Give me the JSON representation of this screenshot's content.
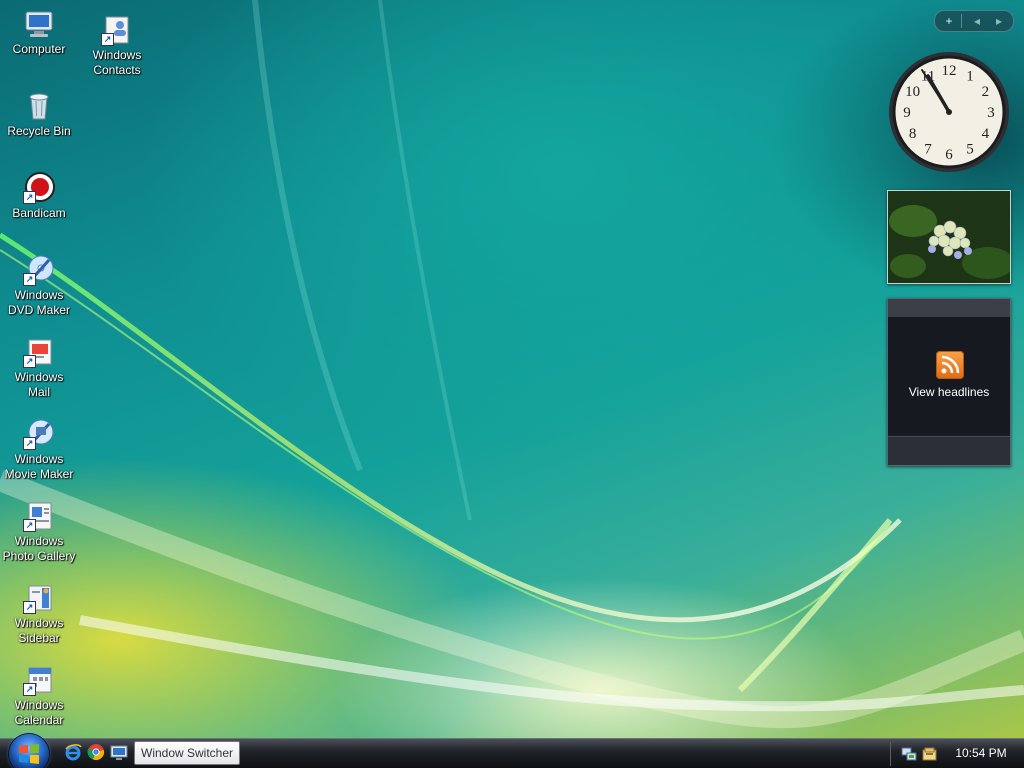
{
  "desktop": {
    "icons": [
      {
        "label": "Computer",
        "icon": "computer-icon"
      },
      {
        "label": "Windows\nContacts",
        "icon": "contacts-icon"
      },
      {
        "label": "Recycle Bin",
        "icon": "recycle-bin-icon"
      },
      {
        "label": "Bandicam",
        "icon": "bandicam-icon"
      },
      {
        "label": "Windows\nDVD Maker",
        "icon": "dvd-maker-icon"
      },
      {
        "label": "Windows\nMail",
        "icon": "mail-icon"
      },
      {
        "label": "Windows\nMovie Maker",
        "icon": "movie-maker-icon"
      },
      {
        "label": "Windows\nPhoto Gallery",
        "icon": "photo-gallery-icon"
      },
      {
        "label": "Windows\nSidebar",
        "icon": "sidebar-icon"
      },
      {
        "label": "Windows\nCalendar",
        "icon": "calendar-icon"
      }
    ]
  },
  "sidebar": {
    "controls": {
      "add": "+",
      "prev": "◂",
      "next": "▸"
    },
    "clock": {
      "numbers": [
        "12",
        "1",
        "2",
        "3",
        "4",
        "5",
        "6",
        "7",
        "8",
        "9",
        "10",
        "11"
      ]
    },
    "feed": {
      "label": "View headlines"
    }
  },
  "taskbar": {
    "tooltip": "Window Switcher",
    "quick_launch": [
      "internet-explorer-icon",
      "chrome-icon",
      "show-desktop-icon"
    ],
    "time": "10:54 PM"
  }
}
